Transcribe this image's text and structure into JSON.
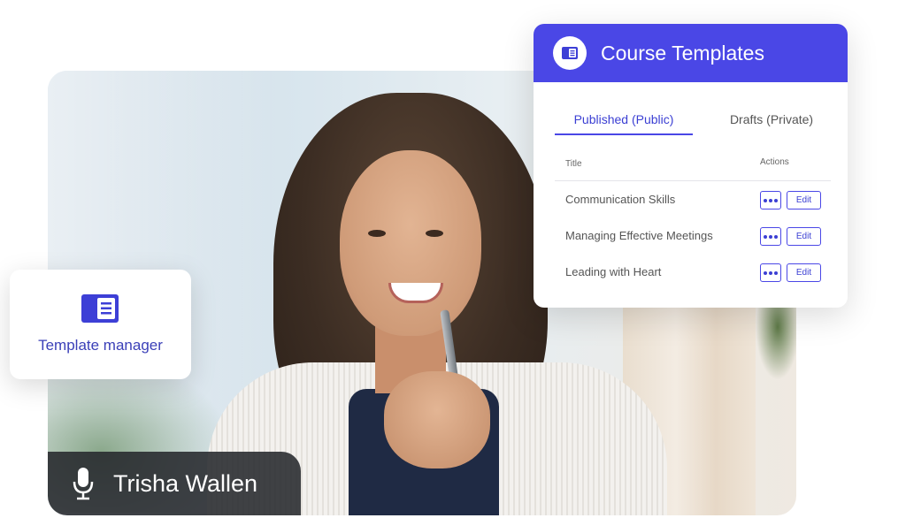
{
  "video": {
    "speaker_name": "Trisha Wallen",
    "mic_icon": "microphone-icon"
  },
  "template_manager_card": {
    "icon": "template-icon",
    "label": "Template manager"
  },
  "course_templates": {
    "title": "Course Templates",
    "header_icon": "template-icon",
    "accent_color": "#4a47e6",
    "tabs": [
      {
        "label": "Published (Public)",
        "active": true
      },
      {
        "label": "Drafts (Private)",
        "active": false
      }
    ],
    "columns": {
      "title": "Title",
      "actions": "Actions"
    },
    "rows": [
      {
        "title": "Communication Skills",
        "edit_label": "Edit"
      },
      {
        "title": "Managing Effective Meetings",
        "edit_label": "Edit"
      },
      {
        "title": "Leading with Heart",
        "edit_label": "Edit"
      }
    ]
  }
}
